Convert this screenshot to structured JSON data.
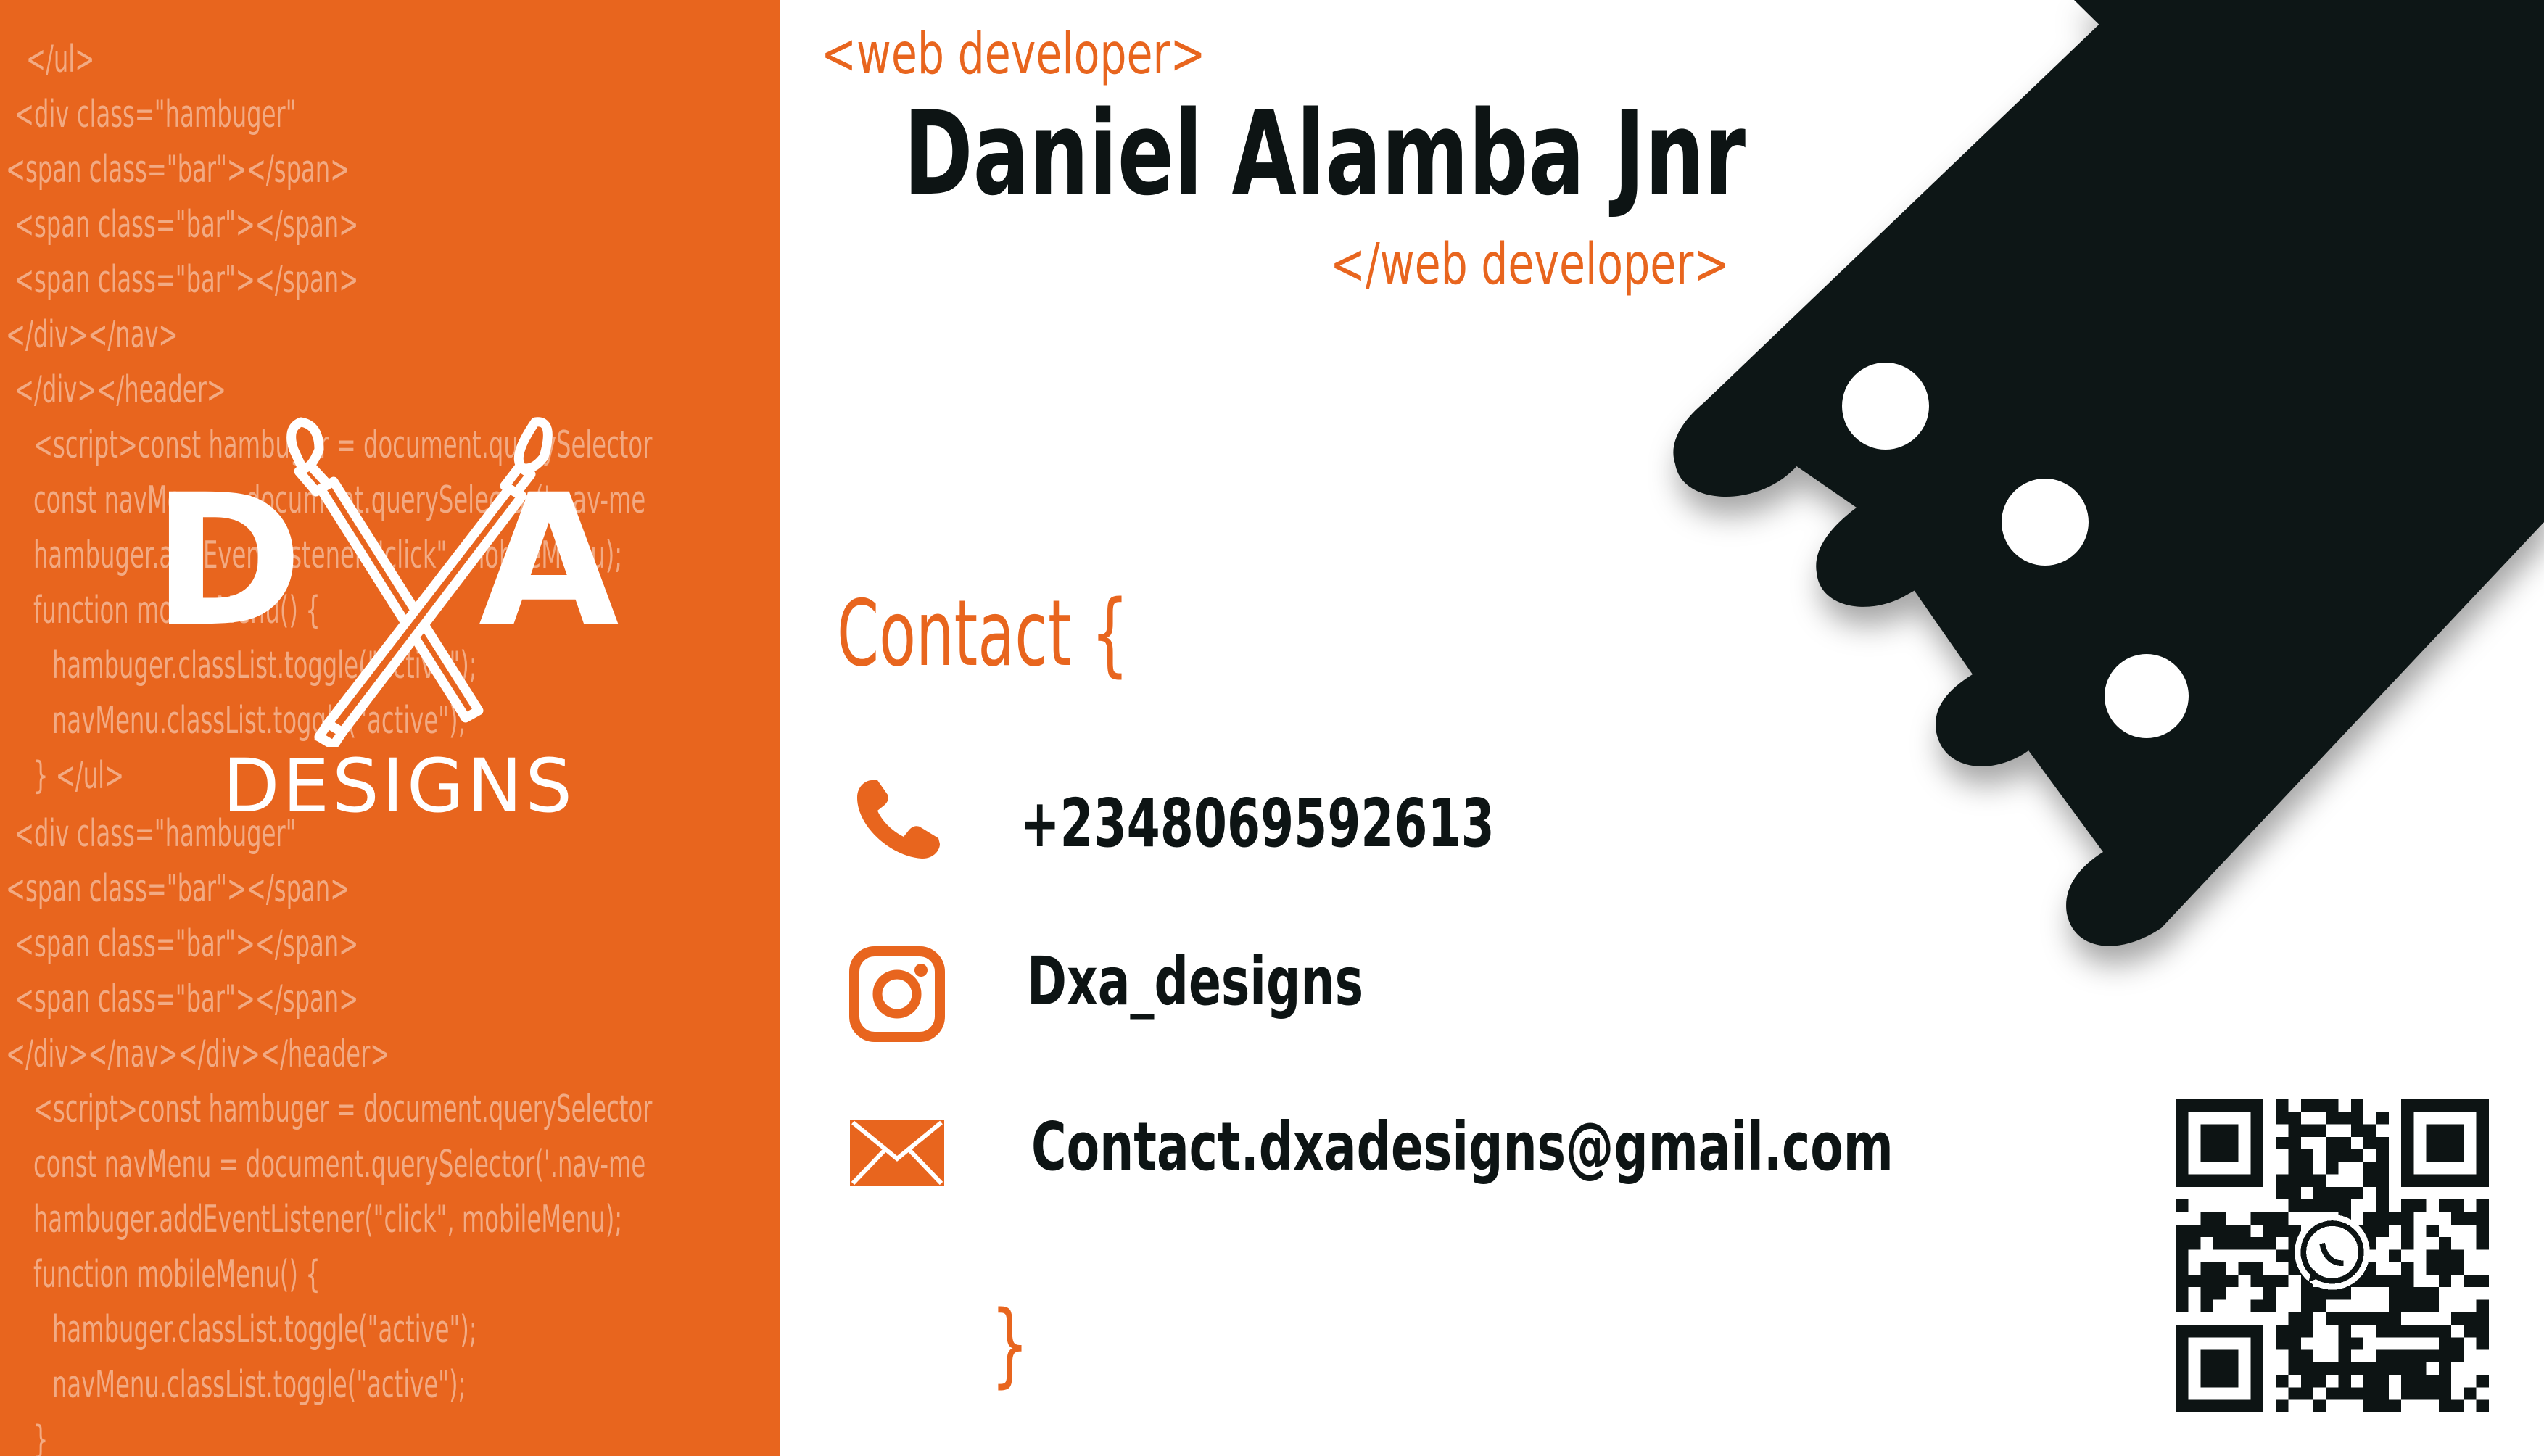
{
  "card": {
    "code_lines": [
      "</ul>",
      "<div class=\"hambuger\"",
      "<span class=\"bar\"></span>",
      "<span class=\"bar\"></span>",
      "<span class=\"bar\"></span>",
      "</div></nav>",
      "</div></header>",
      "<script>const hambuger = document.querySelector",
      "const navMenu = document.querySelector('.nav-me",
      "hambuger.addEventListener(\"click\", mobileMenu);",
      "function mobileMenu() {",
      "hambuger.classList.toggle(\"active\");",
      "navMenu.classList.toggle(\"active\");",
      "}  </ul>",
      "<div class=\"hambuger\"",
      "<span class=\"bar\"></span>",
      "<span class=\"bar\"></span>",
      "<span class=\"bar\"></span>",
      "</div></nav></div></header>",
      "<script>const hambuger = document.querySelector",
      "const navMenu = document.querySelector('.nav-me",
      "hambuger.addEventListener(\"click\", mobileMenu);",
      "function mobileMenu() {",
      "hambuger.classList.toggle(\"active\");",
      "navMenu.classList.toggle(\"active\");",
      "}"
    ],
    "logo": {
      "letter_left": "D",
      "letter_middle": "X",
      "letter_right": "A",
      "wordmark": "DESIGNS"
    },
    "tag_open": "<web developer>",
    "name": "Daniel Alamba Jnr",
    "tag_close": "</web developer>",
    "contact": {
      "heading": "Contact {",
      "phone": "+2348069592613",
      "instagram": "Dxa_designs",
      "email": "Contact.dxadesigns@gmail.com",
      "closing": "}"
    },
    "icons": {
      "phone": "phone-icon",
      "instagram": "instagram-icon",
      "email": "envelope-icon",
      "whatsapp": "whatsapp-icon"
    },
    "colors": {
      "accent": "#e8651e",
      "dark": "#0d1414",
      "background": "#ffffff"
    }
  }
}
